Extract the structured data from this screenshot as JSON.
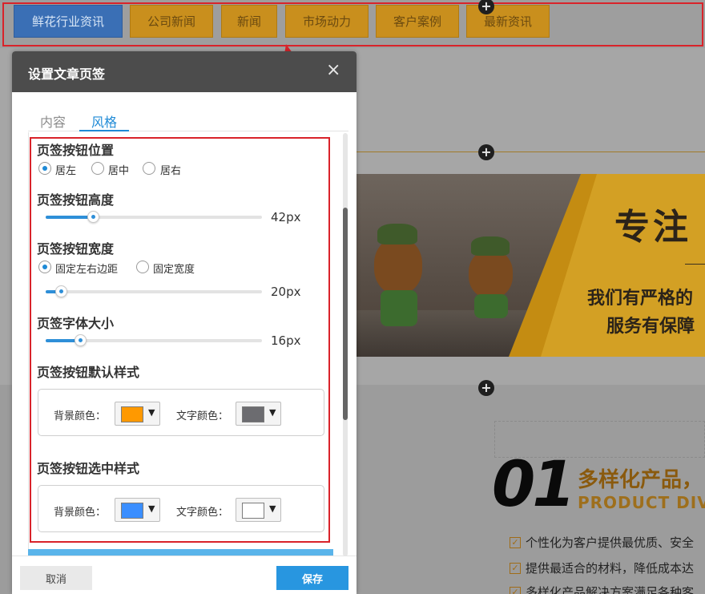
{
  "page_tabs": [
    {
      "label": "鲜花行业资讯",
      "active": true
    },
    {
      "label": "公司新闻",
      "active": false
    },
    {
      "label": "新闻",
      "active": false
    },
    {
      "label": "市场动力",
      "active": false
    },
    {
      "label": "客户案例",
      "active": false
    },
    {
      "label": "最新资讯",
      "active": false
    }
  ],
  "banner": {
    "title": "专注",
    "sub1": "我们有严格的",
    "sub2": "服务有保障"
  },
  "feature": {
    "number": "01",
    "title": "多样化产品，",
    "title_en": "PRODUCT DIVE",
    "items": [
      "个性化为客户提供最优质、安全",
      "提供最适合的材料，降低成本达",
      "多样化产品解决方案满足各种客"
    ]
  },
  "dialog": {
    "title": "设置文章页签",
    "close_icon": "×",
    "tabs": [
      {
        "label": "内容",
        "active": false
      },
      {
        "label": "风格",
        "active": true
      }
    ],
    "position": {
      "label": "页签按钮位置",
      "options": [
        "居左",
        "居中",
        "居右"
      ],
      "selected": "居左"
    },
    "height": {
      "label": "页签按钮高度",
      "value": "42px",
      "percent": 22
    },
    "width": {
      "label": "页签按钮宽度",
      "options": [
        "固定左右边距",
        "固定宽度"
      ],
      "selected": "固定左右边距",
      "value": "20px",
      "percent": 7
    },
    "font_size": {
      "label": "页签字体大小",
      "value": "16px",
      "percent": 16
    },
    "default_style": {
      "label": "页签按钮默认样式",
      "bg_label": "背景颜色：",
      "bg_color": "#ff9900",
      "text_label": "文字颜色：",
      "text_color": "#6c6c70"
    },
    "selected_style": {
      "label": "页签按钮选中样式",
      "bg_label": "背景颜色：",
      "bg_color": "#3a8eff",
      "text_label": "文字颜色：",
      "text_color": "#ffffff"
    },
    "cancel_label": "取消",
    "save_label": "保存"
  }
}
